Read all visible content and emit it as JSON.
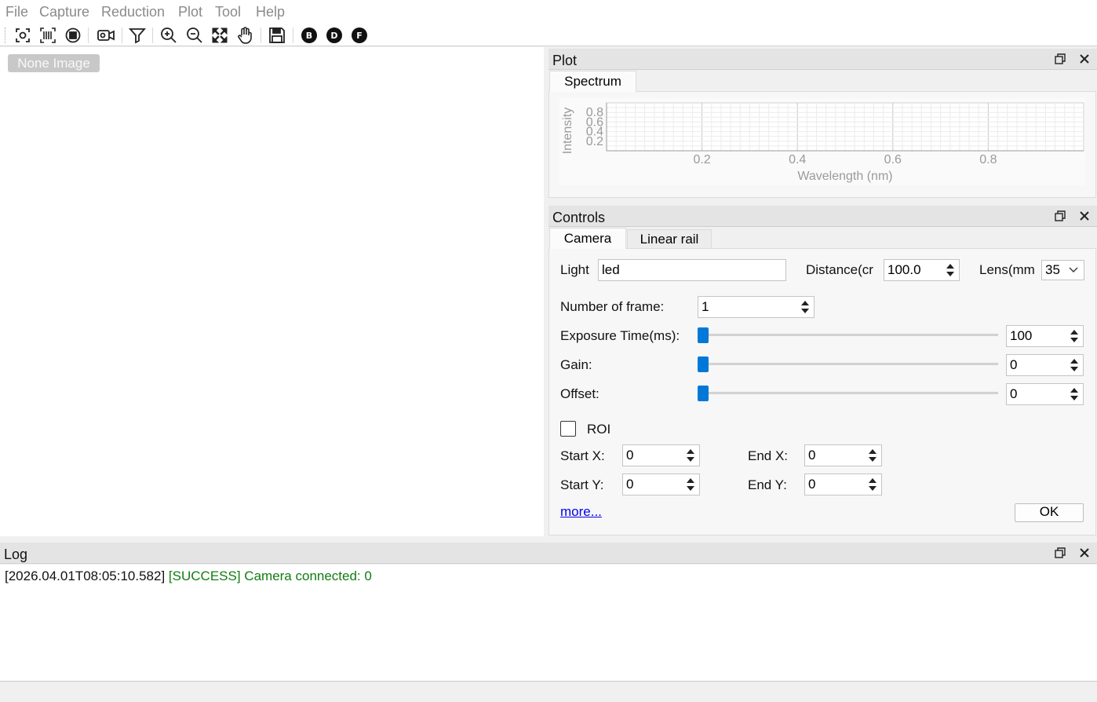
{
  "menu": [
    "File",
    "Capture",
    "Reduction",
    "Plot",
    "Tool",
    "Help"
  ],
  "toolbar": {
    "icons": [
      "screenshot-icon",
      "barcode-scan-icon",
      "stop-record-icon",
      "video-camera-icon",
      "filter-icon",
      "zoom-in-icon",
      "zoom-out-icon",
      "fit-screen-icon",
      "pan-hand-icon",
      "save-icon",
      "b-icon",
      "d-icon",
      "f-icon"
    ],
    "letters": {
      "b": "B",
      "d": "D",
      "f": "F"
    }
  },
  "image_area": {
    "placeholder": "None Image"
  },
  "plot_panel": {
    "title": "Plot",
    "tabs": [
      "Spectrum"
    ],
    "chart_data": {
      "type": "line",
      "xlabel": "Wavelength (nm)",
      "ylabel": "Intensity",
      "xticks": [
        "0.2",
        "0.4",
        "0.6",
        "0.8"
      ],
      "yticks": [
        "0.2",
        "0.4",
        "0.6",
        "0.8"
      ],
      "xlim": [
        0,
        1
      ],
      "ylim": [
        0,
        1
      ],
      "grid": true,
      "series": []
    }
  },
  "controls_panel": {
    "title": "Controls",
    "tabs": [
      "Camera",
      "Linear rail"
    ],
    "light_label": "Light",
    "light_value": "led",
    "distance_label": "Distance(cr",
    "distance_value": "100.0",
    "lens_label": "Lens(mm",
    "lens_value": "35",
    "frames_label": "Number of frame:",
    "frames_value": "1",
    "exposure_label": "Exposure Time(ms):",
    "exposure_value": "100",
    "exposure_level": 0,
    "gain_label": "Gain:",
    "gain_value": "0",
    "gain_level": 0,
    "offset_label": "Offset:",
    "offset_value": "0",
    "offset_level": 0,
    "roi_label": "ROI",
    "roi_checked": false,
    "start_x_label": "Start X:",
    "start_x_value": "0",
    "end_x_label": "End X:",
    "end_x_value": "0",
    "start_y_label": "Start Y:",
    "start_y_value": "0",
    "end_y_label": "End Y:",
    "end_y_value": "0",
    "more_link": "more...",
    "ok_button": "OK"
  },
  "log_panel": {
    "title": "Log",
    "entries": [
      {
        "timestamp": "[2026.04.01T08:05:10.582]",
        "level": "[SUCCESS]",
        "message": "Camera connected: 0"
      }
    ]
  },
  "colors": {
    "accent": "#0078d7",
    "success": "#107c10",
    "link": "#0000ee",
    "menu_text": "#8a8a8a"
  }
}
